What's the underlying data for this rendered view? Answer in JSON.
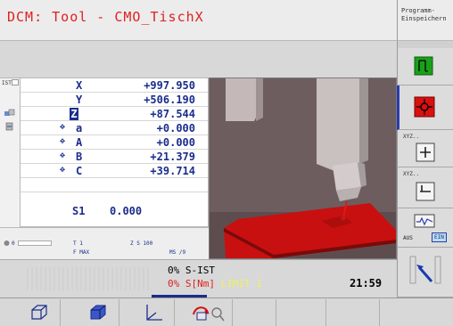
{
  "header": {
    "title": "DCM: Tool - CMO_TischX",
    "side_label": "Programm-\nEinspeichern"
  },
  "position": {
    "ist_label": "IST",
    "rows": [
      {
        "marker": "",
        "axis": "X",
        "value": "+997.950",
        "selected": false
      },
      {
        "marker": "",
        "axis": "Y",
        "value": "+506.190",
        "selected": false
      },
      {
        "marker": "",
        "axis": "Z",
        "value": "+87.544",
        "selected": true
      },
      {
        "marker": "✥",
        "axis": "a",
        "value": "+0.000",
        "selected": false
      },
      {
        "marker": "✥",
        "axis": "A",
        "value": "+0.000",
        "selected": false
      },
      {
        "marker": "✥",
        "axis": "B",
        "value": "+21.379",
        "selected": false
      },
      {
        "marker": "✥",
        "axis": "C",
        "value": "+39.714",
        "selected": false
      }
    ],
    "spindle_label": "S1",
    "spindle_value": "0.000"
  },
  "status": {
    "tool_t": "T 1",
    "tool_z": "Z S 100",
    "feed_label": "F MAX",
    "ms": "MS /9",
    "counter": "0"
  },
  "feed": {
    "row1_pct": "0%",
    "row1_label": "S-IST",
    "row2_pct": "0%",
    "row2_label": "S[Nm]",
    "limit_label": "LIMIT 1",
    "clock": "21:59"
  },
  "right_softkeys": {
    "xyz1": "XYZ..",
    "xyz2": "XYZ..",
    "aus": "AUS",
    "ein": "EIN"
  },
  "colors": {
    "title_red": "#e02020",
    "axis_blue": "#1a2d8c",
    "table_red": "#d01010",
    "green_icon": "#1aa01a"
  }
}
